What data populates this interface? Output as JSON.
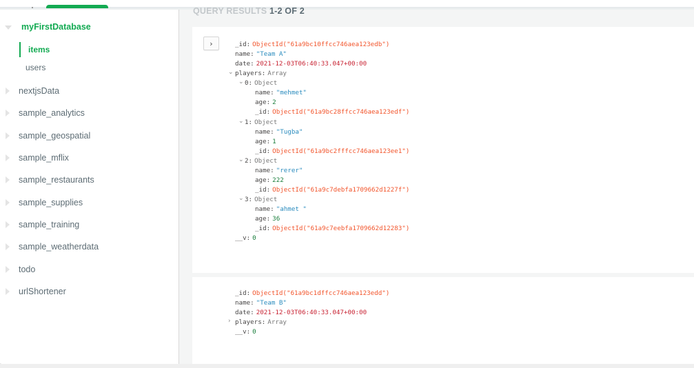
{
  "sidebar": {
    "open_database": "myFirstDatabase",
    "collections": [
      {
        "label": "items",
        "active": true
      },
      {
        "label": "users",
        "active": false
      }
    ],
    "databases": [
      "nextjsData",
      "sample_analytics",
      "sample_geospatial",
      "sample_mflix",
      "sample_restaurants",
      "sample_supplies",
      "sample_training",
      "sample_weatherdata",
      "todo",
      "urlShortener"
    ]
  },
  "results": {
    "label": "QUERY RESULTS",
    "count": "1-2 OF 2"
  },
  "documents": [
    {
      "expand_icon": "chevron-right-icon",
      "fields": {
        "id_key": "_id",
        "id_val": "ObjectId(\"61a9bc10ffcc746aea123edb\")",
        "name_key": "name",
        "name_val": "\"Team A\"",
        "date_key": "date",
        "date_val": "2021-12-03T06:40:33.047+00:00",
        "players_key": "players",
        "players_type": "Array",
        "v_key": "__v",
        "v_val": "0"
      },
      "players": [
        {
          "index": "0",
          "type": "Object",
          "name": "\"mehmet\"",
          "age": "2",
          "id": "ObjectId(\"61a9bc28ffcc746aea123edf\")"
        },
        {
          "index": "1",
          "type": "Object",
          "name": "\"Tugba\"",
          "age": "1",
          "id": "ObjectId(\"61a9bc2fffcc746aea123ee1\")"
        },
        {
          "index": "2",
          "type": "Object",
          "name": "\"rerer\"",
          "age": "222",
          "id": "ObjectId(\"61a9c7debfa1709662d1227f\")"
        },
        {
          "index": "3",
          "type": "Object",
          "name": "\"ahmet \"",
          "age": "36",
          "id": "ObjectId(\"61a9c7eebfa1709662d12283\")"
        }
      ]
    },
    {
      "fields": {
        "id_key": "_id",
        "id_val": "ObjectId(\"61a9bc1dffcc746aea123edd\")",
        "name_key": "name",
        "name_val": "\"Team B\"",
        "date_key": "date",
        "date_val": "2021-12-03T06:40:33.047+00:00",
        "players_key": "players",
        "players_type": "Array",
        "v_key": "__v",
        "v_val": "0"
      }
    }
  ],
  "labels": {
    "name": "name",
    "age": "age",
    "id": "_id",
    "colon": ":"
  },
  "colors": {
    "accent": "#13aa52",
    "objectid": "#f2552c",
    "string": "#2b8cbe",
    "date": "#c82333",
    "number": "#1a7e3c"
  }
}
